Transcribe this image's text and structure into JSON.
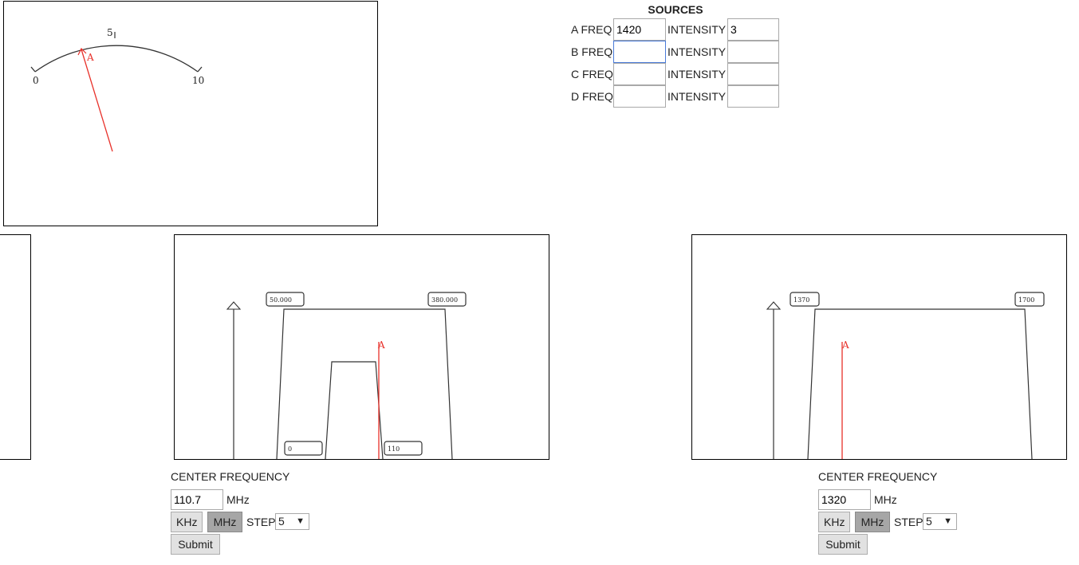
{
  "meter": {
    "scale_labels": [
      "0",
      "5",
      "10"
    ],
    "source_marker": "A",
    "colors": {
      "scale": "#333333",
      "needle": "#e8312a"
    }
  },
  "sources": {
    "title": "SOURCES",
    "intensity_label": "INTENSITY",
    "rows": [
      {
        "label": "A FREQ",
        "freq": "1420",
        "intensity": "3"
      },
      {
        "label": "B FREQ",
        "freq": "",
        "intensity": ""
      },
      {
        "label": "C FREQ",
        "freq": "",
        "intensity": ""
      },
      {
        "label": "D FREQ",
        "freq": "",
        "intensity": ""
      }
    ]
  },
  "spectrum_1": {
    "outer_band": {
      "low_label": "50.000",
      "high_label": "380.000"
    },
    "inner_band": {
      "low_label": "0",
      "high_label": "110"
    },
    "source_marker": "A"
  },
  "spectrum_2": {
    "band": {
      "low_label": "1370",
      "high_label": "1700"
    },
    "source_marker": "A"
  },
  "controls_1": {
    "center_frequency_label": "CENTER FREQUENCY",
    "center_frequency_value": "110.7",
    "unit": "MHz",
    "khz_label": "KHz",
    "mhz_label": "MHz",
    "step_label": "STEP",
    "step_value": "5",
    "submit_label": "Submit"
  },
  "controls_2": {
    "center_frequency_label": "CENTER FREQUENCY",
    "center_frequency_value": "1320",
    "unit": "MHz",
    "khz_label": "KHz",
    "mhz_label": "MHz",
    "step_label": "STEP",
    "step_value": "5",
    "submit_label": "Submit"
  }
}
